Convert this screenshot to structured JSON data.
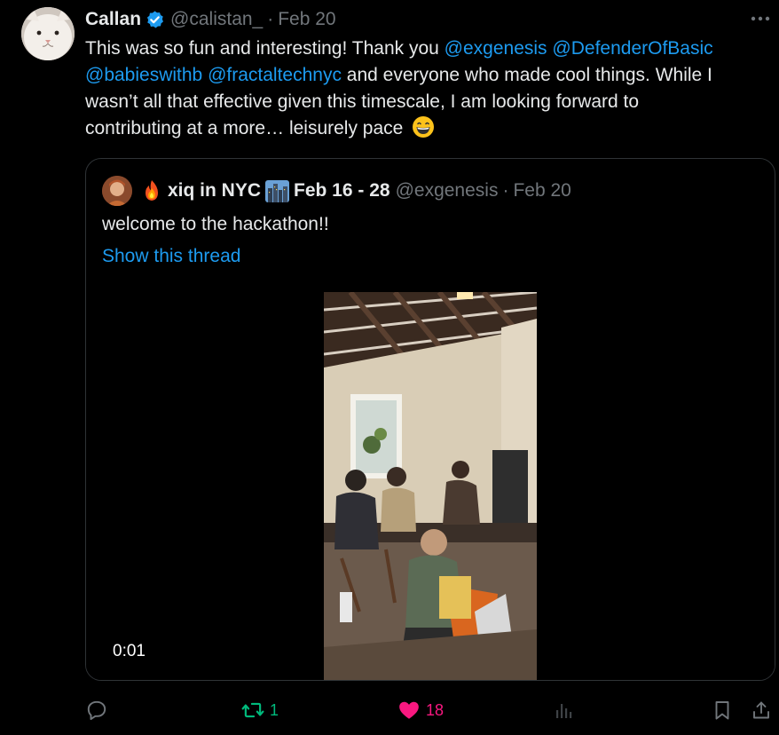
{
  "author": {
    "name": "Callan",
    "handle": "@calistan_",
    "separator": "·",
    "date": "Feb 20"
  },
  "tweet": {
    "line1_pre": "This was so fun and interesting! Thank you ",
    "mention1": "@exgenesis",
    "mention2": "@DefenderOfBasic",
    "mention3": "@babieswithb",
    "mention4": "@fractaltechnyc",
    "line2_post": " and everyone who made cool things. While I",
    "line3": "wasn’t all that effective given this timescale, I am looking forward to",
    "line4": "contributing at a more… leisurely pace"
  },
  "quote": {
    "name": "xiq in NYC",
    "dates": "Feb 16 - 28",
    "handle": "@exgenesis",
    "separator": "·",
    "date": "Feb 20",
    "text": "welcome to the hackathon!!",
    "show_thread": "Show this thread",
    "video_time": "0:01"
  },
  "actions": {
    "retweets": "1",
    "likes": "18"
  },
  "colors": {
    "background": "#000000",
    "text": "#e7e9ea",
    "muted": "#71767b",
    "link": "#1d9bf0",
    "retweet": "#00ba7c",
    "like": "#f91880",
    "border": "#2f3336"
  },
  "icons": [
    "cat-avatar-icon",
    "verified-badge-icon",
    "more-icon",
    "grinning-emoji-icon",
    "fire-emoji-icon",
    "cityscape-emoji-icon",
    "reply-icon",
    "retweet-icon",
    "heart-icon",
    "views-icon",
    "bookmark-icon",
    "share-icon"
  ]
}
